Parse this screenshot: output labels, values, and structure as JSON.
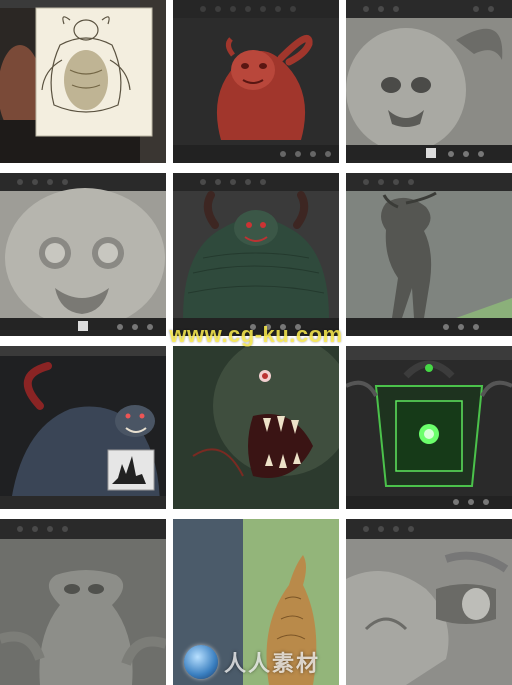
{
  "watermark": {
    "site": "www.cg-ku.com",
    "logo_text": "人人素材"
  },
  "tiles": [
    {
      "name": "concept-sketch-screenshot",
      "subject": "pencil concept sketch of horned demon over dark ZBrush UI"
    },
    {
      "name": "red-bust-screenshot",
      "subject": "red clay demon bust with curled horn"
    },
    {
      "name": "grey-skull-screenshot",
      "subject": "grey sculpt of demon face with horn"
    },
    {
      "name": "face-closeup-screenshot",
      "subject": "close-up grey sculpt of demon face"
    },
    {
      "name": "green-bust-screenshot",
      "subject": "dark green scaly demon bust with horns"
    },
    {
      "name": "alien-creature-screenshot",
      "subject": "grey alien creature full body"
    },
    {
      "name": "painted-demon-screenshot",
      "subject": "painted demon with red horn and histogram dialog"
    },
    {
      "name": "mouth-closeup-screenshot",
      "subject": "close-up of demon mouth with fangs"
    },
    {
      "name": "lantern-screenshot",
      "subject": "green glowing ornamental lantern"
    },
    {
      "name": "grey-alien-torso-screenshot",
      "subject": "grey alien torso sculpt"
    },
    {
      "name": "golden-creature-screenshot",
      "subject": "golden creature on green background"
    },
    {
      "name": "mechanical-sculpt-screenshot",
      "subject": "grey mechanical organic sculpt close-up"
    }
  ]
}
